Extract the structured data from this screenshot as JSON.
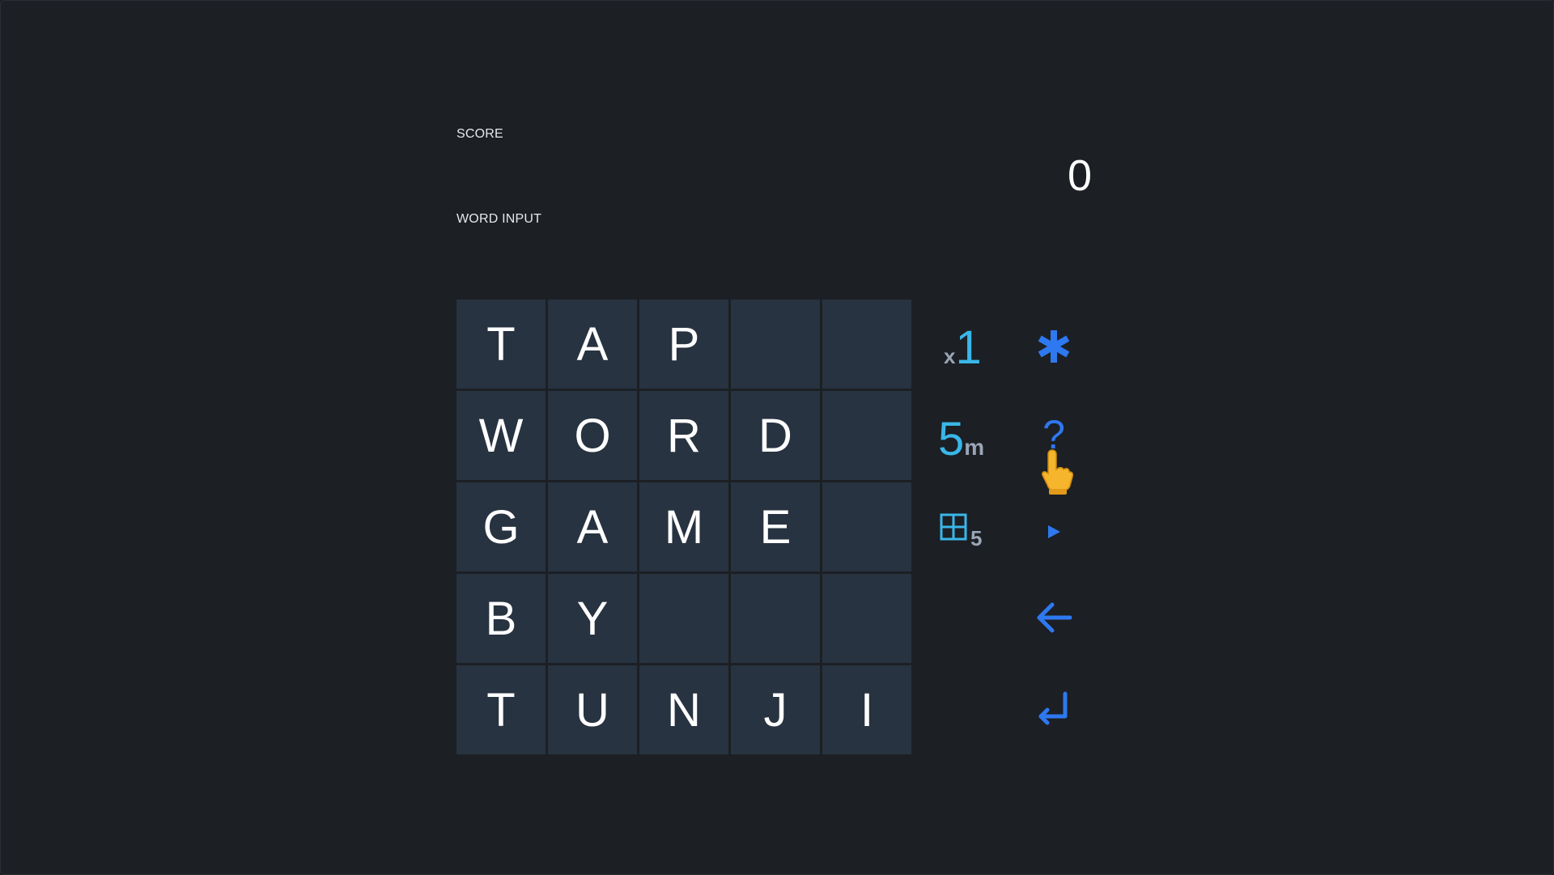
{
  "score": {
    "label": "SCORE",
    "value": "0"
  },
  "word_input": {
    "label": "WORD INPUT",
    "value": ""
  },
  "board": {
    "rows": [
      [
        "T",
        "A",
        "P",
        "",
        ""
      ],
      [
        "W",
        "O",
        "R",
        "D",
        ""
      ],
      [
        "G",
        "A",
        "M",
        "E",
        ""
      ],
      [
        "B",
        "Y",
        "",
        "",
        ""
      ],
      [
        "T",
        "U",
        "N",
        "J",
        "I"
      ]
    ]
  },
  "stats": {
    "multiplier_prefix": "x",
    "multiplier_value": "1",
    "timer_value": "5",
    "timer_unit": "m",
    "grid_size": "5",
    "grid_icon": "grid-icon"
  },
  "controls": {
    "star_icon": "asterisk-icon",
    "help_label": "?",
    "play_icon": "play-icon",
    "back_icon": "arrow-left-icon",
    "enter_icon": "enter-return-icon",
    "pointer_icon": "pointing-hand-icon"
  },
  "colors": {
    "background": "#1c1f24",
    "tile": "#283341",
    "accent_cyan": "#3ab6e8",
    "accent_blue": "#2e78f0",
    "muted": "#9aa6b6"
  }
}
